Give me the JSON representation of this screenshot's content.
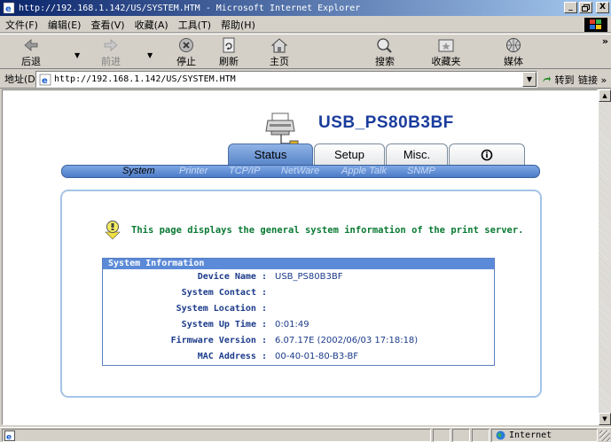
{
  "window": {
    "title": "http://192.168.1.142/US/SYSTEM.HTM - Microsoft Internet Explorer",
    "controls": [
      "_",
      "8",
      "X"
    ]
  },
  "menu": {
    "items": [
      "文件(F)",
      "编辑(E)",
      "查看(V)",
      "收藏(A)",
      "工具(T)",
      "帮助(H)"
    ]
  },
  "toolbar": {
    "back": "后退",
    "forward": "前进",
    "stop": "停止",
    "refresh": "刷新",
    "home": "主页",
    "search": "搜索",
    "favorites": "收藏夹",
    "media": "媒体",
    "more": "»"
  },
  "address": {
    "label": "地址(D)",
    "url": "http://192.168.1.142/US/SYSTEM.HTM",
    "go": "转到",
    "links": "链接 »"
  },
  "page": {
    "device_name": "USB_PS80B3BF",
    "tabs": [
      "Status",
      "Setup",
      "Misc.",
      "ⓘ"
    ],
    "active_tab": "Status",
    "subnav": [
      "System",
      "Printer",
      "TCP/IP",
      "NetWare",
      "Apple Talk",
      "SNMP"
    ],
    "active_subnav": "System",
    "notice": "This page displays the general system information of the print server.",
    "sysinfo": {
      "title": "System Information",
      "rows": [
        {
          "label": "Device Name :",
          "value": "USB_PS80B3BF"
        },
        {
          "label": "System Contact :",
          "value": ""
        },
        {
          "label": "System Location :",
          "value": ""
        },
        {
          "label": "System Up Time :",
          "value": "0:01:49"
        },
        {
          "label": "Firmware Version :",
          "value": "6.07.17E (2002/06/03 17:18:18)"
        },
        {
          "label": "MAC Address :",
          "value": "00-40-01-80-B3-BF"
        }
      ]
    }
  },
  "status": {
    "zone": "Internet"
  },
  "colors": {
    "title_start": "#0a246a",
    "title_end": "#a6caf0",
    "device_name": "#1a3c9c",
    "notice_text": "#0a7a33",
    "sysinfo_header": "#5b8ad8"
  }
}
